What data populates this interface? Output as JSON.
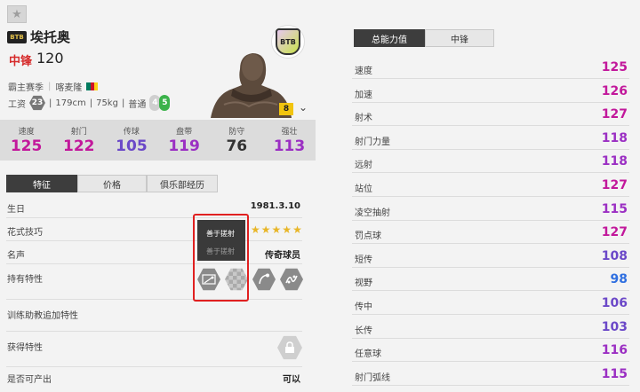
{
  "player": {
    "season_badge": "BTB",
    "name": "埃托奥",
    "position": "中锋",
    "overall": "120",
    "season": "霸主赛季",
    "nationality": "喀麦隆",
    "wage_label": "工资",
    "wage": "23",
    "height": "179cm",
    "weight": "75kg",
    "body_type": "普通",
    "weak_foot": "4",
    "strong_foot": "5",
    "level": "8",
    "club_logo_text": "BTB",
    "flag_colors": [
      "#007a5e",
      "#ce1126",
      "#fcd116"
    ]
  },
  "stats": [
    {
      "label": "速度",
      "value": "125",
      "color": "#c2189b"
    },
    {
      "label": "射门",
      "value": "122",
      "color": "#c2189b"
    },
    {
      "label": "传球",
      "value": "105",
      "color": "#6b48c8"
    },
    {
      "label": "盘带",
      "value": "119",
      "color": "#9b2fc3"
    },
    {
      "label": "防守",
      "value": "76",
      "color": "#333333"
    },
    {
      "label": "强壮",
      "value": "113",
      "color": "#9b2fc3"
    }
  ],
  "left_tabs": [
    "特征",
    "价格",
    "俱乐部经历"
  ],
  "info": {
    "birthday_label": "生日",
    "birthday": "1981.3.10",
    "skill_label": "花式技巧",
    "fame_label": "名声",
    "fame": "传奇球员",
    "traits_label": "持有特性",
    "training_label": "训练助教追加特性",
    "acquired_label": "获得特性",
    "producible_label": "是否可产出",
    "producible": "可以"
  },
  "tooltip": {
    "line1": "善于搓射",
    "line2": "善于搓射"
  },
  "right_tabs": [
    "总能力值",
    "中锋"
  ],
  "attributes": [
    {
      "label": "速度",
      "value": "125",
      "color": "#c2189b"
    },
    {
      "label": "加速",
      "value": "126",
      "color": "#c2189b"
    },
    {
      "label": "射术",
      "value": "127",
      "color": "#c2189b"
    },
    {
      "label": "射门力量",
      "value": "118",
      "color": "#9b2fc3"
    },
    {
      "label": "远射",
      "value": "118",
      "color": "#9b2fc3"
    },
    {
      "label": "站位",
      "value": "127",
      "color": "#c2189b"
    },
    {
      "label": "凌空抽射",
      "value": "115",
      "color": "#9b2fc3"
    },
    {
      "label": "罚点球",
      "value": "127",
      "color": "#c2189b"
    },
    {
      "label": "短传",
      "value": "108",
      "color": "#6b48c8"
    },
    {
      "label": "视野",
      "value": "98",
      "color": "#2f6fe0"
    },
    {
      "label": "传中",
      "value": "106",
      "color": "#6b48c8"
    },
    {
      "label": "长传",
      "value": "103",
      "color": "#6b48c8"
    },
    {
      "label": "任意球",
      "value": "116",
      "color": "#9b2fc3"
    },
    {
      "label": "射门弧线",
      "value": "115",
      "color": "#9b2fc3"
    }
  ]
}
